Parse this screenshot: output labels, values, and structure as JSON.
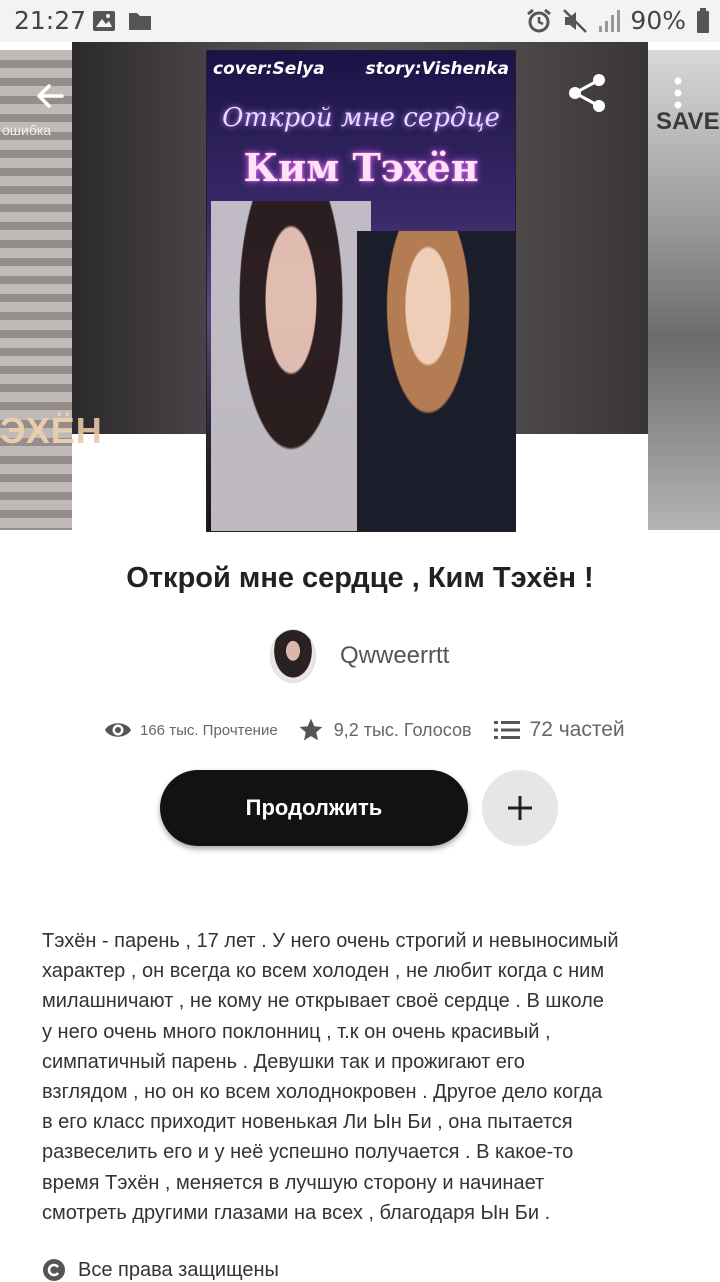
{
  "status_bar": {
    "time": "21:27",
    "battery": "90%",
    "icons": [
      "image-icon",
      "folder-icon",
      "alarm-icon",
      "mute-icon",
      "signal-icon",
      "battery-icon"
    ]
  },
  "hero": {
    "cover_credit_left": "cover:Selya",
    "cover_credit_right": "story:Vishenka",
    "cover_title_line1": "Открой мне сердце",
    "cover_title_line2": "Ким Тэхён",
    "left_book_text": "ЭХЁН",
    "left_book_small": "ошибка",
    "right_book_text": "SAVE"
  },
  "story": {
    "title": "Открой мне сердце , Ким Тэхён !",
    "author": "Qwweerrtt",
    "reads": "166 тыс. Прочтение",
    "votes": "9,2 тыс. Голосов",
    "parts": "72 частей",
    "continue_label": "Продолжить",
    "description": "Тэхён - парень , 17 лет . У него очень строгий и невыносимый\nхарактер , он всегда ко всем холоден , не любит когда с ним\nмилашничают , не кому не открывает своё сердце . В школе\nу него очень много поклонниц , т.к он очень красивый ,\nсимпатичный парень . Девушки так и прожигают его\nвзглядом , но он ко всем холоднокровен . Другое дело когда\nв его класс приходит новенькая Ли Ын Би , она пытается\nразвеселить его и у неё успешно получается . В какое-то\nвремя Тэхён , меняется в лучшую сторону и начинает\nсмотреть другими глазами на всех , благодаря Ын Би .",
    "rights": "Все права защищены"
  },
  "colors": {
    "continue_bg": "#121212",
    "add_bg": "#e6e6e6",
    "status_bg": "#f3f3f3"
  }
}
